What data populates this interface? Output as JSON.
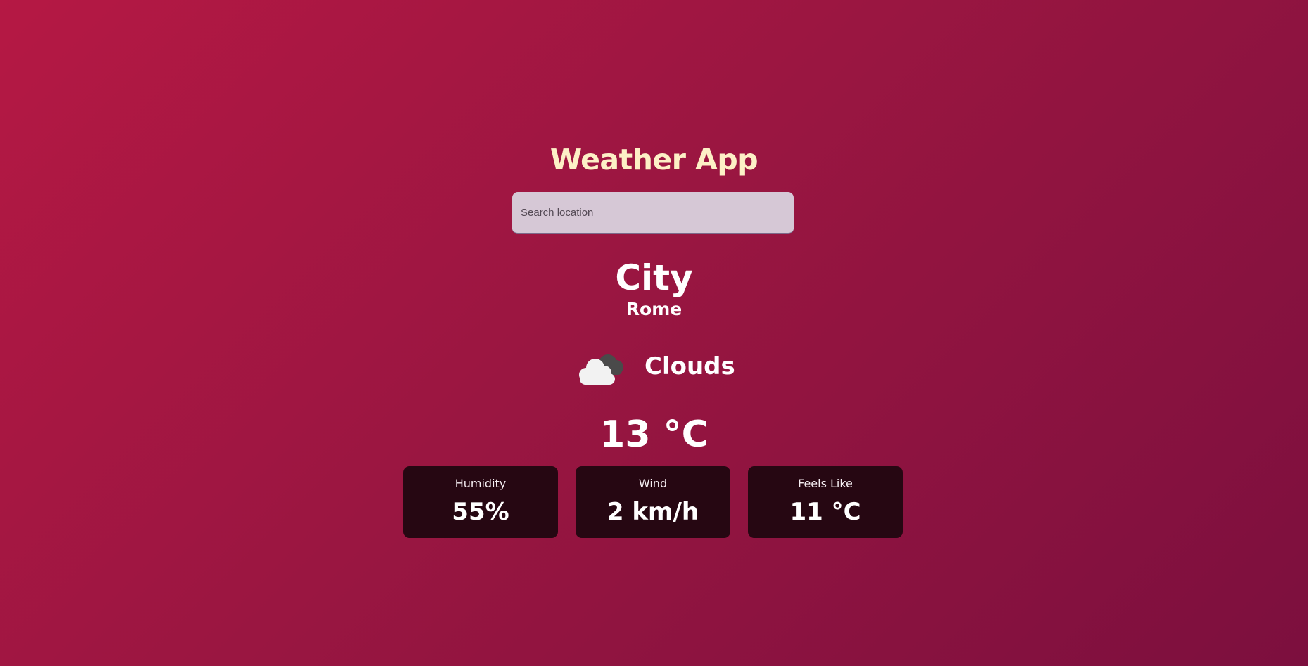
{
  "app": {
    "title": "Weather App",
    "background_colors": [
      "#b51844",
      "#9a1641",
      "#7c0f3e"
    ],
    "title_color": "#fdf0c6"
  },
  "search": {
    "placeholder": "Search location",
    "value": ""
  },
  "location": {
    "label": "City",
    "name": "Rome"
  },
  "weather": {
    "icon": "clouds-icon",
    "condition": "Clouds",
    "temperature": "13 °C"
  },
  "details": [
    {
      "label": "Humidity",
      "value": "55%"
    },
    {
      "label": "Wind",
      "value": "2 km/h"
    },
    {
      "label": "Feels Like",
      "value": "11 °C"
    }
  ],
  "card_color": "#260712"
}
